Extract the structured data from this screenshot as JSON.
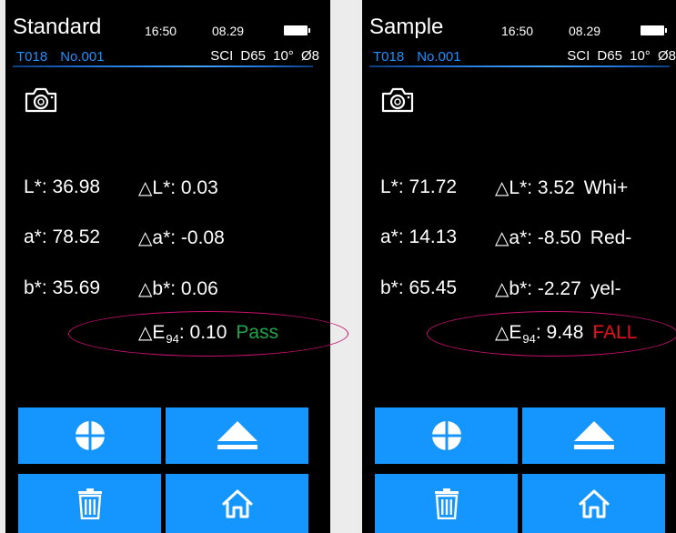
{
  "left": {
    "title": "Standard",
    "time": "16:50",
    "date": "08.29",
    "test_id": "T018",
    "record_no": "No.001",
    "mode": "SCI",
    "illuminant": "D65",
    "observer": "10°",
    "aperture": "Ø8",
    "L": "L*: 36.98",
    "a": "a*: 78.52",
    "b": "b*: 35.69",
    "dL": "L*: 0.03",
    "da": "a*: -0.08",
    "db": "b*: 0.06",
    "dE_prefix": "E",
    "dE_sub": "94",
    "dE_value": ": 0.10",
    "result": "Pass"
  },
  "right": {
    "title": "Sample",
    "time": "16:50",
    "date": "08.29",
    "test_id": "T018",
    "record_no": "No.001",
    "mode": "SCI",
    "illuminant": "D65",
    "observer": "10°",
    "aperture": "Ø8",
    "L": "L*: 71.72",
    "a": "a*: 14.13",
    "b": "b*: 65.45",
    "dL": "L*: 3.52",
    "da": "a*: -8.50",
    "db": "b*: -2.27",
    "dL_dir": "Whi+",
    "da_dir": "Red-",
    "db_dir": "yel-",
    "dE_prefix": "E",
    "dE_sub": "94",
    "dE_value": ": 9.48",
    "result": "FALL"
  },
  "delta_symbol": "△",
  "colors": {
    "accent": "#1596ff",
    "pass": "#1fa54b",
    "fail": "#e8101a",
    "highlight": "#c8106e"
  },
  "icons": [
    "camera-icon",
    "crosshair-icon",
    "eject-icon",
    "trash-icon",
    "home-icon"
  ]
}
